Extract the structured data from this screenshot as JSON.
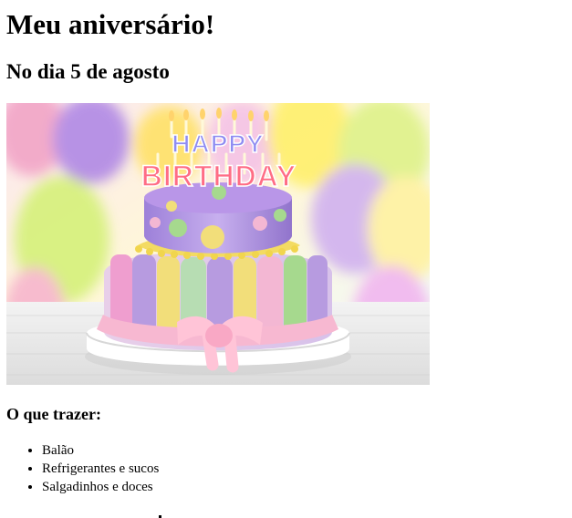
{
  "page": {
    "title": "Meu aniversário!",
    "date_heading": "No dia 5 de agosto",
    "image": {
      "topper_line1": "HAPPY",
      "topper_line2": "BIRTHDAY",
      "colors": {
        "cake_lavender": "#b79be0",
        "cake_pink": "#f3b7d3",
        "cake_yellow": "#f2de7a",
        "cake_green": "#a6d98e",
        "ribbon_pink": "#f6bfd0"
      }
    },
    "bring_heading": "O que trazer:",
    "bring_items": [
      "Balão",
      "Refrigerantes e sucos",
      "Salgadinhos e doces"
    ]
  }
}
